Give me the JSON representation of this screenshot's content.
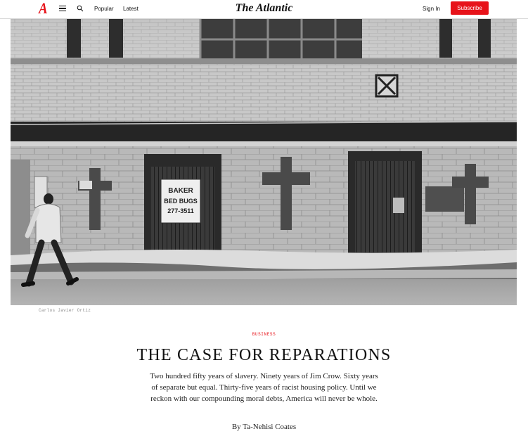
{
  "header": {
    "logo_letter": "A",
    "brand_name": "The Atlantic",
    "nav": {
      "popular": "Popular",
      "latest": "Latest"
    },
    "sign_in": "Sign In",
    "subscribe": "Subscribe",
    "icons": {
      "menu": "hamburger-icon",
      "search": "search-icon"
    },
    "colors": {
      "accent": "#e7131a"
    }
  },
  "hero": {
    "sign_lines": [
      "BAKER",
      "BED BUGS",
      "277-3511"
    ],
    "credit": "Carlos Javier Ortiz"
  },
  "article": {
    "section": "BUSINESS",
    "title": "THE CASE FOR REPARATIONS",
    "dek": "Two hundred fifty years of slavery. Ninety years of Jim Crow. Sixty years of separate but equal. Thirty-five years of racist housing policy. Until we reckon with our compounding moral debts, America will never be whole.",
    "byline_prefix": "By",
    "author": "Ta-Nehisi Coates"
  }
}
